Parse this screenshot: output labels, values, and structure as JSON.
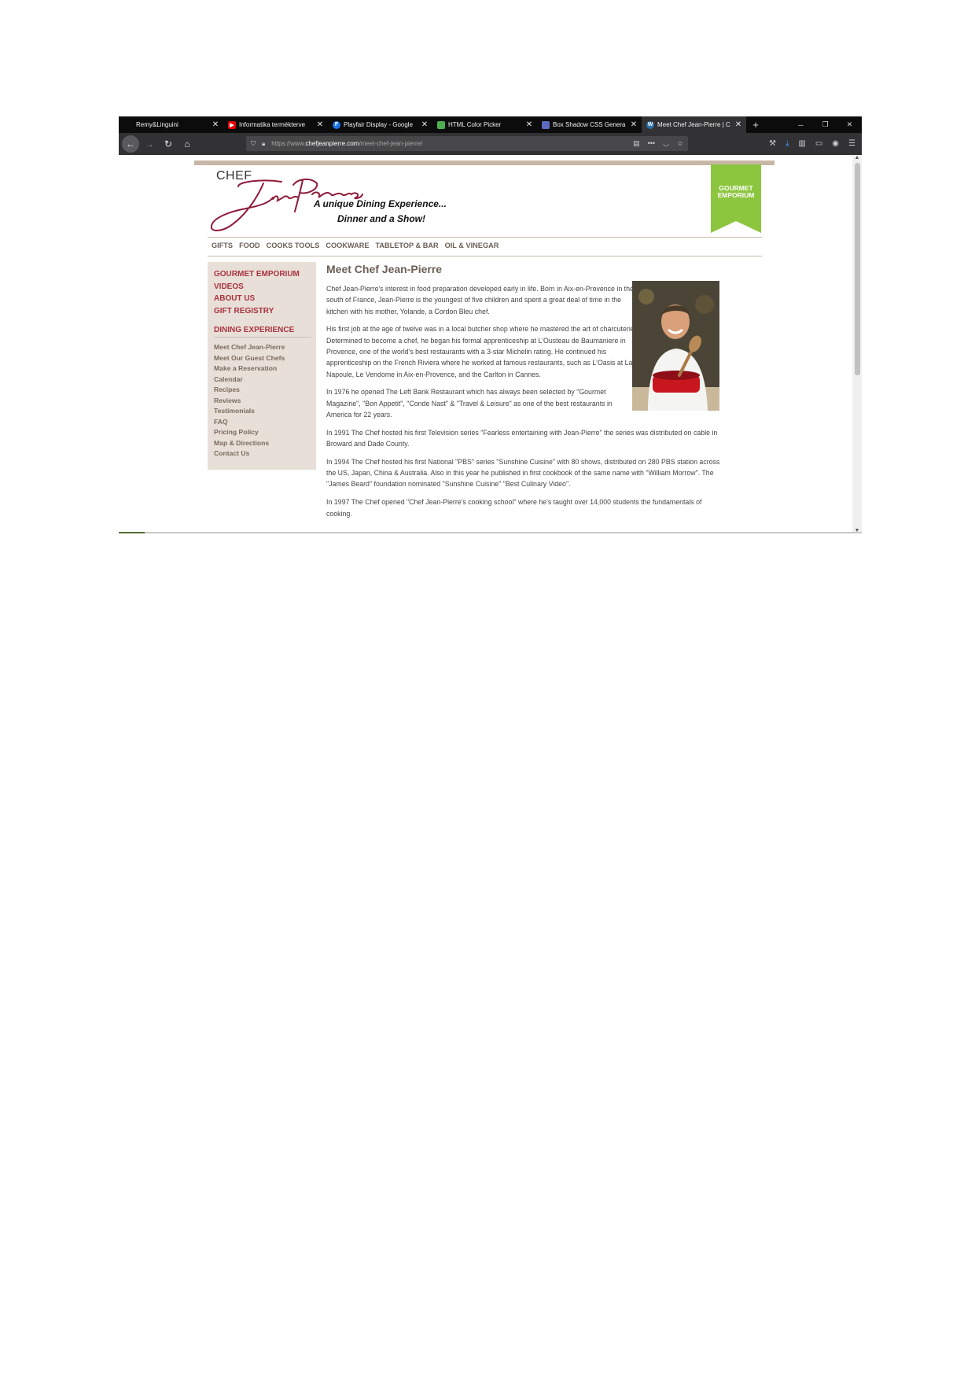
{
  "browser": {
    "tabs": [
      {
        "title": "Remy&Linguini",
        "close": "✕"
      },
      {
        "title": "Informatika termékterve",
        "close": "✕"
      },
      {
        "title": "Playfair Display - Google",
        "close": "✕"
      },
      {
        "title": "HTML Color Picker",
        "close": "✕"
      },
      {
        "title": "Box Shadow CSS Genera",
        "close": "✕"
      },
      {
        "title": "Meet Chef Jean-Pierre | C",
        "close": "✕",
        "active": true
      }
    ],
    "new_tab": "+",
    "url": {
      "prefix": "https://www.",
      "host": "chefjeanpierre.com",
      "path": "/meet-chef-jean-pierre/"
    }
  },
  "site": {
    "logo": {
      "chef": "CHEF",
      "script": "Jean-Pierre's"
    },
    "tagline1": "A unique Dining Experience...",
    "tagline2": "Dinner and a Show!",
    "ribbon": {
      "line1": "GOURMET",
      "line2": "EMPORIUM",
      "color": "#8cc63f"
    },
    "nav": [
      "GIFTS",
      "FOOD",
      "COOKS TOOLS",
      "COOKWARE",
      "TABLETOP & BAR",
      "OIL & VINEGAR"
    ],
    "sidebar": {
      "primary": [
        "GOURMET EMPORIUM",
        "VIDEOS",
        "ABOUT US",
        "GIFT REGISTRY"
      ],
      "heading": "DINING EXPERIENCE",
      "links": [
        "Meet Chef Jean-Pierre",
        "Meet Our Guest Chefs",
        "Make a Reservation",
        "Calendar",
        "Recipes",
        "Reviews",
        "Testimonials",
        "FAQ",
        "Pricing Policy",
        "Map & Directions",
        "Contact Us"
      ]
    },
    "content": {
      "title": "Meet Chef Jean-Pierre",
      "paragraphs": [
        "Chef Jean-Pierre's interest in food preparation developed early in life. Born in Aix-en-Provence in the south of France, Jean-Pierre is the youngest of five children and spent a great deal of time in the kitchen with his mother, Yolande, a Cordon Bleu chef.",
        "His first job at the age of twelve was in a local butcher shop where he mastered the art of charcuterie. Determined to become a chef, he began his formal apprenticeship at L'Ousteau de Baumaniere in Provence, one of the world's best restaurants with a 3-star Michelin rating. He continued his apprenticeship on the French Riviera where he worked at famous restaurants, such as L'Oasis at La Napoule, Le Vendome in Aix-en-Provence, and the Carlton in Cannes.",
        "In 1976 he opened The Left Bank Restaurant which has always been selected by \"Gourmet Magazine\", \"Bon Appetit\", \"Conde Nast\" & \"Travel & Leisure\" as one of the best restaurants in America for 22 years.",
        "In 1991 The Chef hosted his first Television series \"Fearless entertaining with Jean-Pierre\" the series was distributed on cable in Broward and Dade County.",
        "In 1994 The Chef hosted his first National \"PBS\" series \"Sunshine Cuisine\" with 80 shows, distributed on 280 PBS station across the US, Japan, China & Australia. Also in this year he published in first cookbook of the same name with \"William Morrow\". The \"James Beard\" foundation nominated \"Sunshine Cuisine\" \"Best Culinary Video\".",
        "In 1997 The Chef opened \"Chef Jean-Pierre's cooking school\" where he's taught over 14,000 students the fundamentals of cooking."
      ]
    },
    "colors": {
      "accent": "#a83240",
      "nav_text": "#6b5e55",
      "sidebar_bg": "#e8e0d8",
      "strip": "#c8b7a6"
    }
  }
}
